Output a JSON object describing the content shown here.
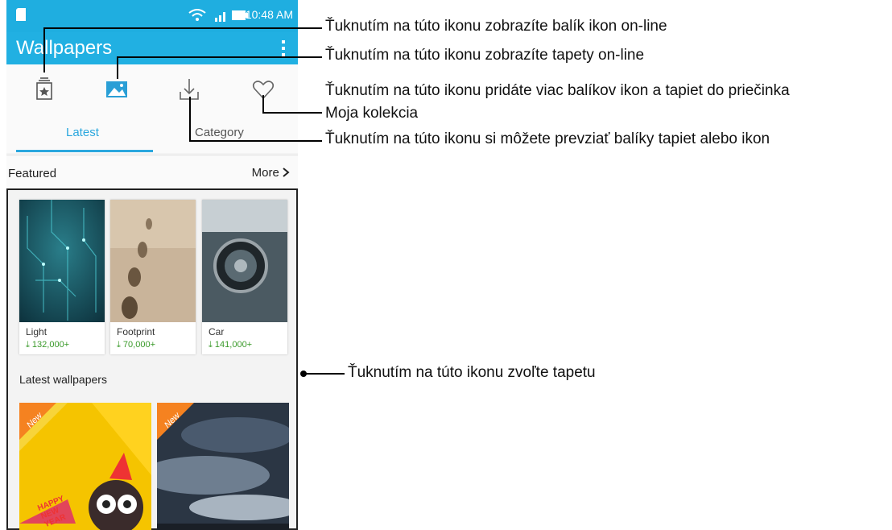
{
  "status": {
    "time": "10:48 AM"
  },
  "appbar": {
    "title": "Wallpapers"
  },
  "tabs": [
    {
      "label": "Latest",
      "active": true
    },
    {
      "label": "Category",
      "active": false
    }
  ],
  "featured": {
    "label": "Featured",
    "more_label": "More",
    "items": [
      {
        "name": "Light",
        "downloads": "132,000+"
      },
      {
        "name": "Footprint",
        "downloads": "70,000+"
      },
      {
        "name": "Car",
        "downloads": "141,000+"
      }
    ]
  },
  "latest": {
    "label": "Latest wallpapers",
    "badge": "New",
    "card_text": "HAPPY NEW YEAR"
  },
  "annotations": [
    "Ťuknutím na túto ikonu zobrazíte balík ikon on-line",
    "Ťuknutím na túto ikonu zobrazíte tapety on-line",
    "Ťuknutím na túto ikonu pridáte viac balíkov ikon a tapiet do priečinka",
    "Moja kolekcia",
    "Ťuknutím na túto ikonu si môžete prevziať balíky tapiet alebo ikon",
    "Ťuknutím na túto ikonu zvoľte tapetu"
  ],
  "colors": {
    "accent": "#21b0e2",
    "download": "#3a9a2a",
    "badge": "#f58220"
  }
}
